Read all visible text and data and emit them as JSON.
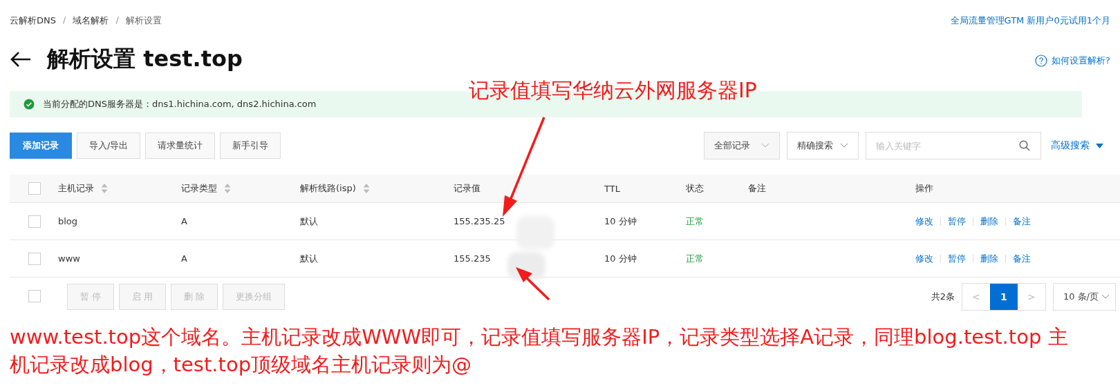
{
  "breadcrumb": [
    {
      "label": "云解析DNS"
    },
    {
      "separator": "/",
      "label": "域名解析"
    },
    {
      "separator": "/",
      "label": "解析设置"
    }
  ],
  "promo_link": "全局流量管理GTM 新用户0元试用1个月",
  "title": "解析设置 test.top",
  "help_link": "如何设置解析?",
  "notice": "当前分配的DNS服务器是：dns1.hichina.com, dns2.hichina.com",
  "toolbar": {
    "buttons": [
      {
        "label": "添加记录",
        "kind": "primary"
      },
      {
        "label": "导入/导出",
        "kind": "default"
      },
      {
        "label": "请求量统计",
        "kind": "default"
      },
      {
        "label": "新手引导",
        "kind": "default"
      }
    ],
    "filter": "全部记录",
    "search_mode": "精确搜索",
    "search": {
      "placeholder": "输入关键字"
    },
    "advanced": "高级搜索"
  },
  "table": {
    "columns": [
      {
        "label": "主机记录",
        "sortable": true
      },
      {
        "label": "记录类型",
        "sortable": true
      },
      {
        "label": "解析线路(isp)",
        "sortable": true
      },
      {
        "label": "记录值",
        "sortable": false
      },
      {
        "label": "TTL",
        "sortable": false
      },
      {
        "label": "状态",
        "sortable": false
      },
      {
        "label": "备注",
        "sortable": false
      },
      {
        "label": "操作",
        "sortable": false
      }
    ],
    "header_checked": false,
    "rows": [
      {
        "checked": false,
        "host": "blog",
        "type": "A",
        "line": "默认",
        "value": "155.235.25",
        "ttl": "10 分钟",
        "status": "正常",
        "actions": [
          "修改",
          "暂停",
          "删除",
          "备注"
        ]
      },
      {
        "checked": false,
        "host": "www",
        "type": "A",
        "line": "默认",
        "value": "155.235",
        "ttl": "10 分钟",
        "status": "正常",
        "actions": [
          "修改",
          "暂停",
          "删除",
          "备注"
        ]
      }
    ]
  },
  "footer": {
    "checked": false,
    "bulk_buttons": [
      {
        "label": "暂 停",
        "disabled": true
      },
      {
        "label": "启 用",
        "disabled": true
      },
      {
        "label": "删 除",
        "disabled": true
      },
      {
        "label": "更换分组",
        "disabled": true
      }
    ],
    "total": "共2条",
    "prev": "<",
    "pages": [
      {
        "label": "1",
        "selected": true
      }
    ],
    "next": ">",
    "page_size": "10 条/页"
  },
  "annotations": [
    "记录值填写华纳云外网服务器IP",
    "www.test.top这个域名。主机记录改成WWW即可，记录值填写服务器IP，记录类型选择A记录，同理blog.test.top 主机记录改成blog，test.top顶级域名主机记录则为@"
  ]
}
